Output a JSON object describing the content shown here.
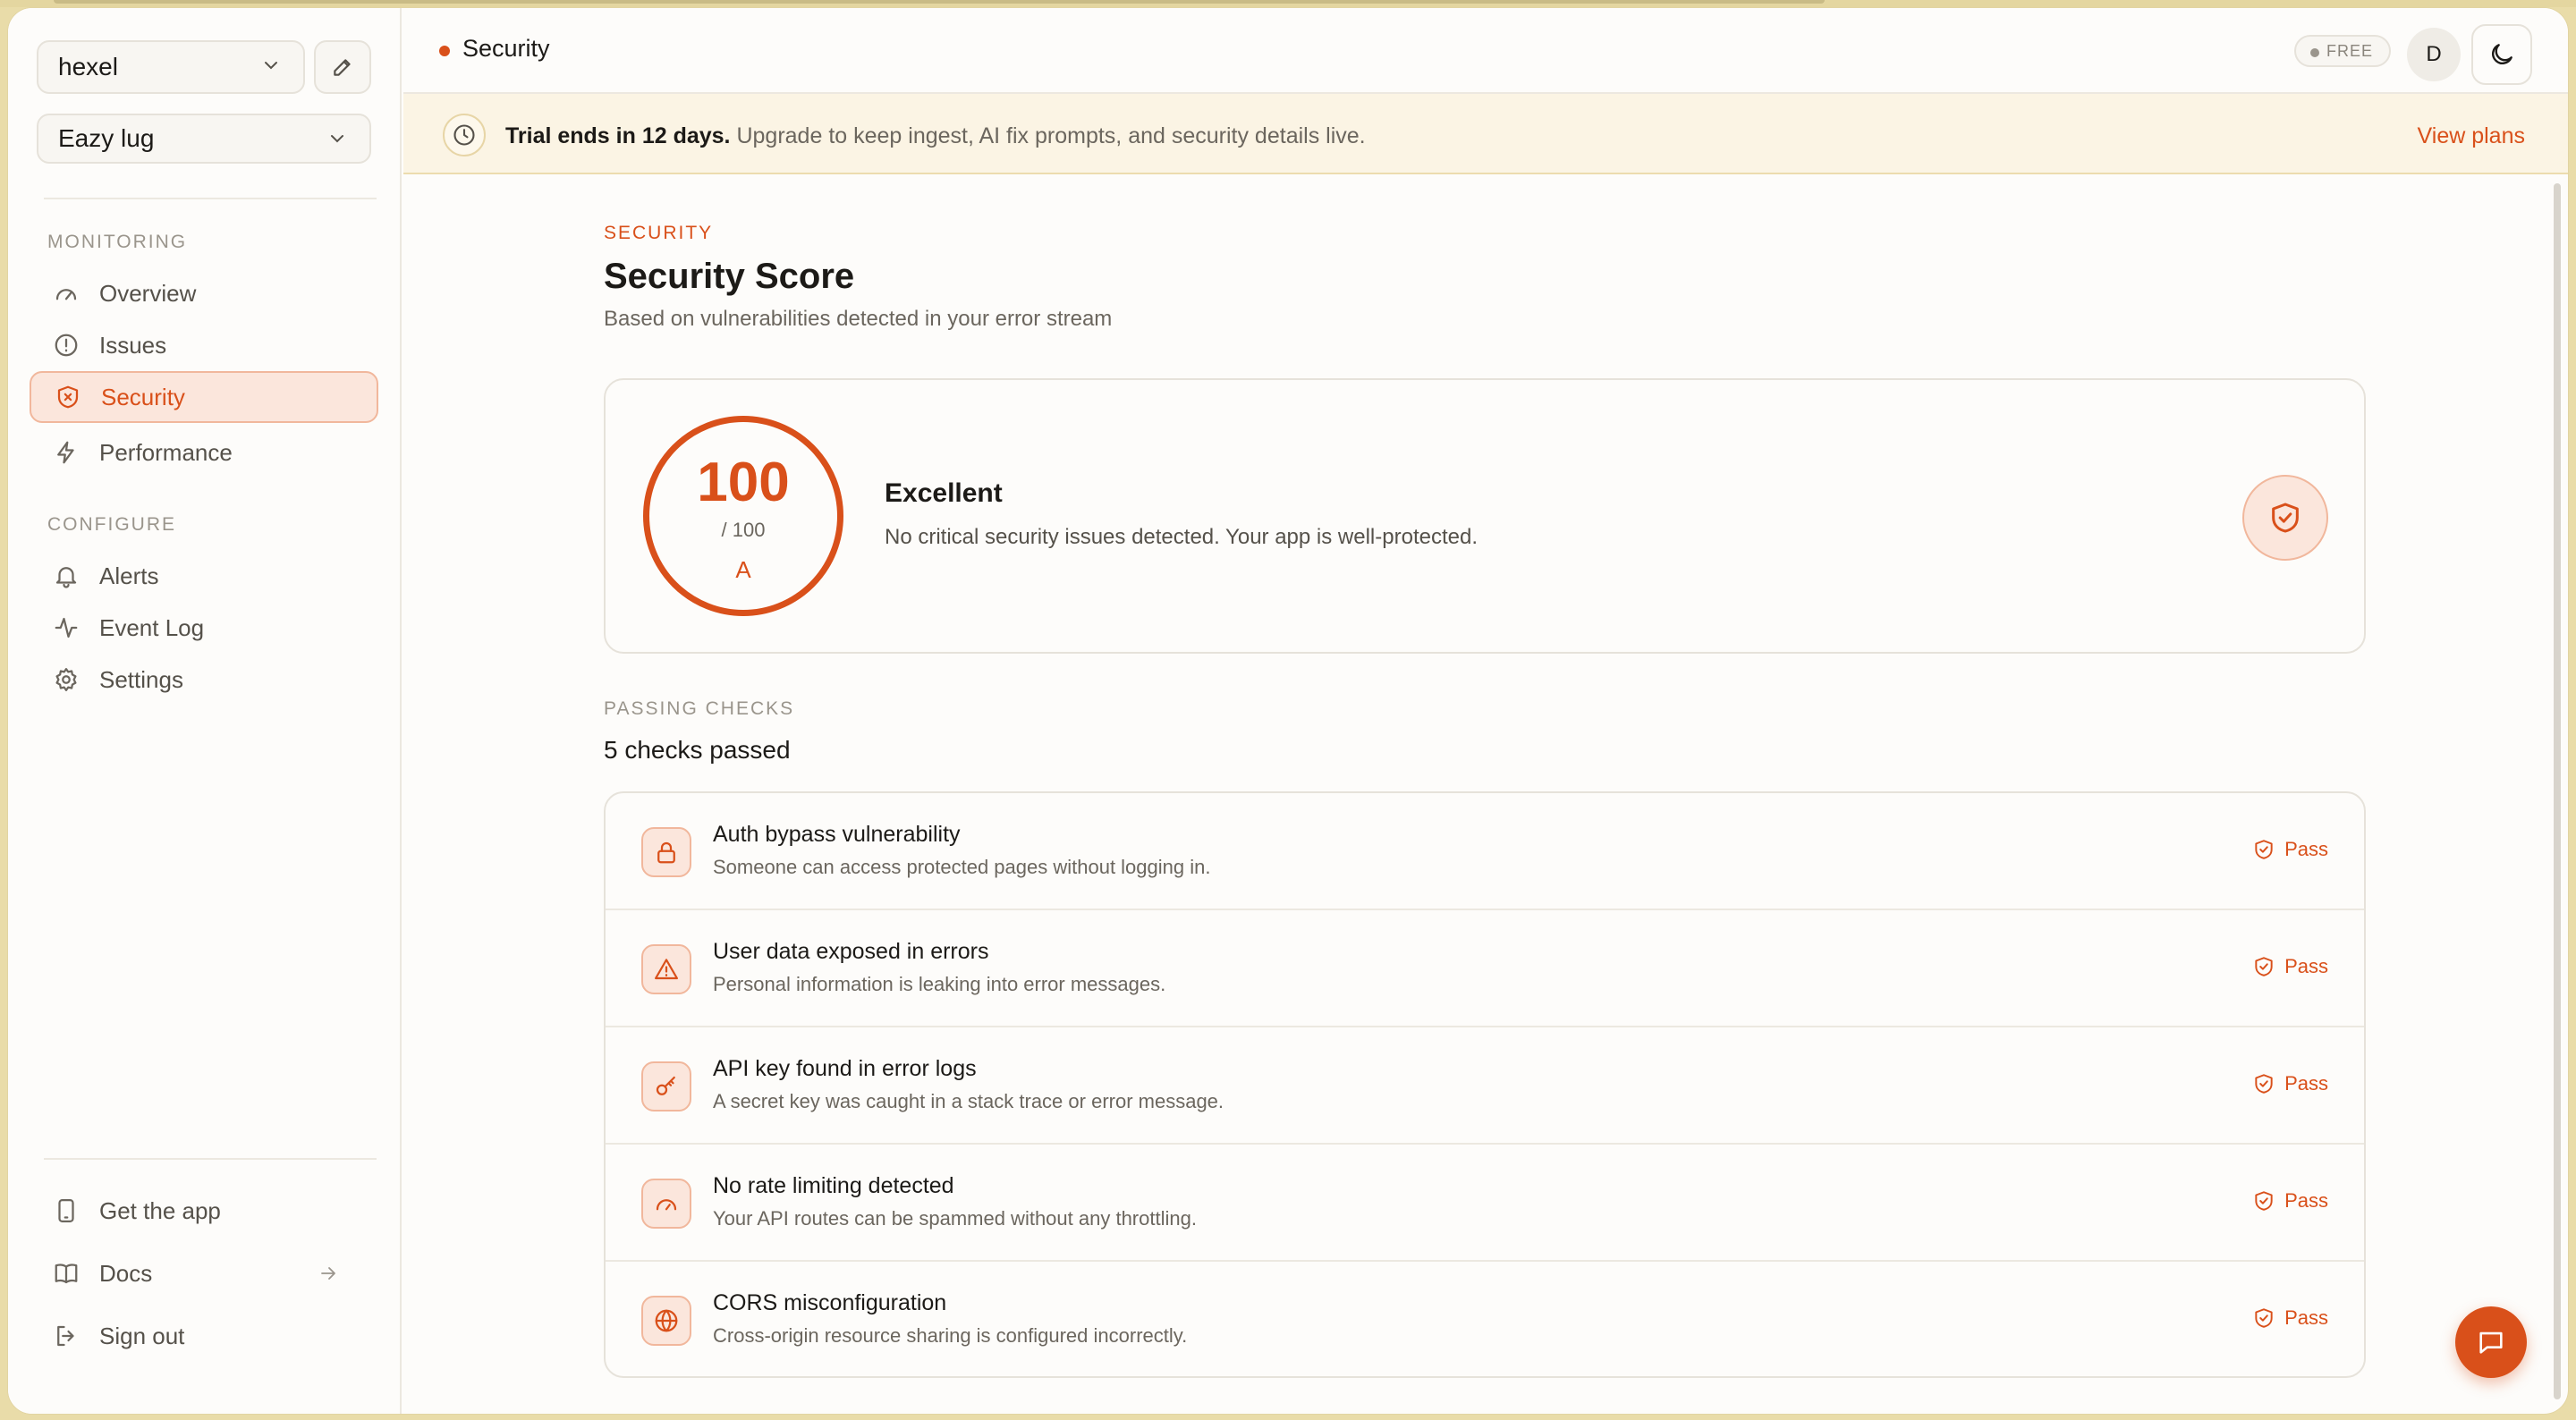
{
  "workspace": {
    "selected": "hexel"
  },
  "project": {
    "selected": "Eazy lug"
  },
  "sidebar": {
    "monitoring_label": "MONITORING",
    "configure_label": "CONFIGURE",
    "monitoring_items": [
      {
        "label": "Overview",
        "icon": "gauge-icon"
      },
      {
        "label": "Issues",
        "icon": "alert-circle-icon"
      },
      {
        "label": "Security",
        "icon": "shield-x-icon",
        "active": true
      },
      {
        "label": "Performance",
        "icon": "bolt-icon"
      }
    ],
    "configure_items": [
      {
        "label": "Alerts",
        "icon": "bell-icon"
      },
      {
        "label": "Event Log",
        "icon": "activity-icon"
      },
      {
        "label": "Settings",
        "icon": "gear-icon"
      }
    ],
    "footer_items": [
      {
        "label": "Get the app",
        "icon": "phone-icon"
      },
      {
        "label": "Docs",
        "icon": "book-icon"
      },
      {
        "label": "Sign out",
        "icon": "logout-icon"
      }
    ]
  },
  "header": {
    "breadcrumb": "Security",
    "plan_badge": "FREE",
    "avatar_initial": "D"
  },
  "trial": {
    "headline": "Trial ends in 12 days.",
    "message": "Upgrade to keep ingest, AI fix prompts, and security details live.",
    "cta": "View plans"
  },
  "page": {
    "kicker": "SECURITY",
    "title": "Security Score",
    "subtitle": "Based on vulnerabilities detected in your error stream"
  },
  "score": {
    "value": "100",
    "max": "/ 100",
    "grade": "A",
    "label": "Excellent",
    "description": "No critical security issues detected. Your app is well-protected."
  },
  "checks": {
    "kicker": "PASSING CHECKS",
    "title": "5 checks passed",
    "items": [
      {
        "title": "Auth bypass vulnerability",
        "description": "Someone can access protected pages without logging in.",
        "status": "Pass",
        "icon": "lock-icon"
      },
      {
        "title": "User data exposed in errors",
        "description": "Personal information is leaking into error messages.",
        "status": "Pass",
        "icon": "warning-triangle-icon"
      },
      {
        "title": "API key found in error logs",
        "description": "A secret key was caught in a stack trace or error message.",
        "status": "Pass",
        "icon": "key-icon"
      },
      {
        "title": "No rate limiting detected",
        "description": "Your API routes can be spammed without any throttling.",
        "status": "Pass",
        "icon": "speedometer-icon"
      },
      {
        "title": "CORS misconfiguration",
        "description": "Cross-origin resource sharing is configured incorrectly.",
        "status": "Pass",
        "icon": "globe-icon"
      }
    ]
  },
  "colors": {
    "accent": "#d9501a",
    "accent_soft": "#fbe6dc",
    "trial_bg": "#fbf4e4"
  }
}
